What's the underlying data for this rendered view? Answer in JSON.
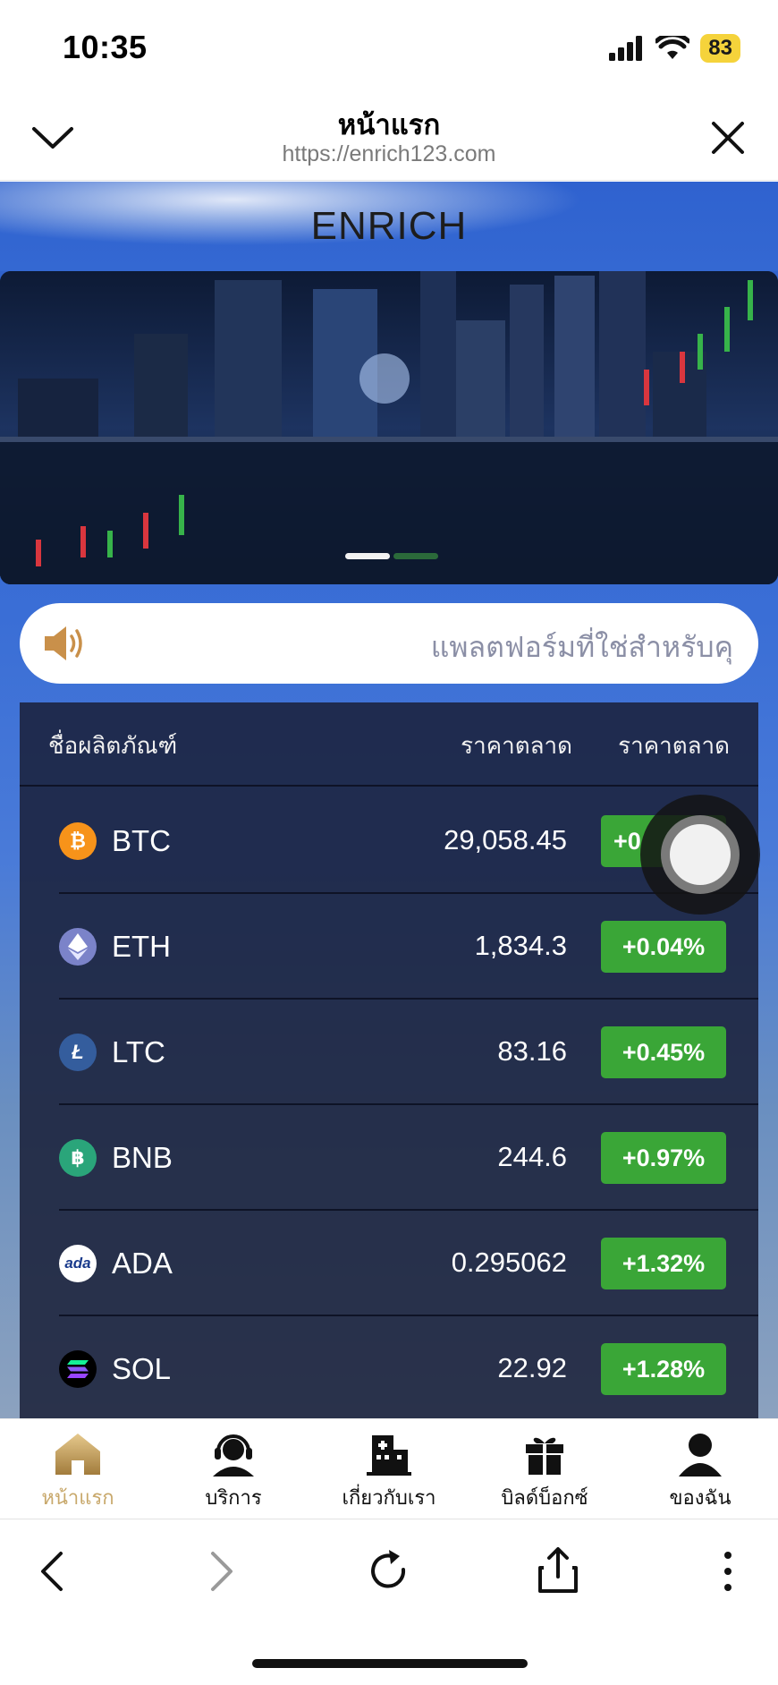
{
  "status_bar": {
    "time": "10:35",
    "battery": "83",
    "icons": [
      "signal-icon",
      "wifi-icon",
      "battery-icon"
    ]
  },
  "browser": {
    "title": "หน้าแรก",
    "url": "https://enrich123.com",
    "icons": [
      "chevron-down-icon",
      "close-icon"
    ]
  },
  "site": {
    "title": "ENRICH",
    "notice_text": "แพลตฟอร์มที่ใช่สำหรับคุ",
    "notice_icon": "speaker-icon"
  },
  "market": {
    "headers": {
      "name": "ชื่อผลิตภัณฑ์",
      "price": "ราคาตลาด",
      "change": "ราคาตลาด"
    },
    "rows": [
      {
        "symbol": "BTC",
        "price": "29,058.45",
        "change": "+0",
        "icon": "bitcoin-icon",
        "color": "#f7931a",
        "glyph": "₿"
      },
      {
        "symbol": "ETH",
        "price": "1,834.3",
        "change": "+0.04%",
        "icon": "ethereum-icon",
        "color": "#7b83c9",
        "glyph": "◆"
      },
      {
        "symbol": "LTC",
        "price": "83.16",
        "change": "+0.45%",
        "icon": "litecoin-icon",
        "color": "#345d9d",
        "glyph": "Ł"
      },
      {
        "symbol": "BNB",
        "price": "244.6",
        "change": "+0.97%",
        "icon": "bnb-icon",
        "color": "#2aa57a",
        "glyph": "฿"
      },
      {
        "symbol": "ADA",
        "price": "0.295062",
        "change": "+1.32%",
        "icon": "cardano-icon",
        "color": "#ffffff",
        "glyph": "ada"
      },
      {
        "symbol": "SOL",
        "price": "22.92",
        "change": "+1.28%",
        "icon": "solana-icon",
        "color": "#000000",
        "glyph": "≡"
      }
    ],
    "change_color": "#3aa637"
  },
  "app_nav": {
    "items": [
      {
        "label": "หน้าแรก",
        "icon": "home-icon",
        "active": true
      },
      {
        "label": "บริการ",
        "icon": "headset-icon",
        "active": false
      },
      {
        "label": "เกี่ยวกับเรา",
        "icon": "building-icon",
        "active": false
      },
      {
        "label": "บิลด์บ็อกซ์",
        "icon": "gift-icon",
        "active": false
      },
      {
        "label": "ของฉัน",
        "icon": "user-icon",
        "active": false
      }
    ],
    "active_color": "#c8a86b"
  },
  "toolbar": {
    "icons": [
      "back-icon",
      "forward-icon",
      "reload-icon",
      "share-icon",
      "more-icon"
    ]
  }
}
